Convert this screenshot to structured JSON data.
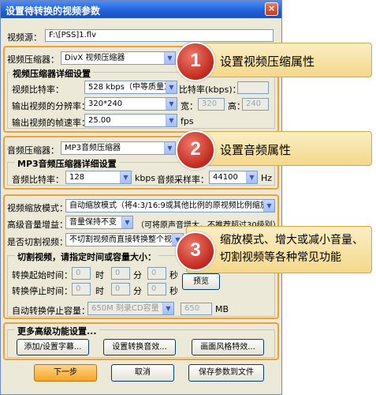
{
  "window": {
    "title": "设置待转换的视频参数",
    "close_glyph": "×"
  },
  "source": {
    "label": "视频源：",
    "value": "F:\\[PSS]1.flv"
  },
  "video_codec": {
    "label": "视频压缩器：",
    "value": "DivX 视频压缩器"
  },
  "video_detail": {
    "group_title": "视频压缩器详细设置",
    "bitrate_label": "视频比特率：",
    "bitrate_value": "528  kbps（中等质量）",
    "bitrate_unit_label": "比特率(kbps)：",
    "bitrate_unit_value": "",
    "resolution_label": "输出视频的分辨率：",
    "resolution_value": "320*240",
    "width_label": "宽：",
    "width_value": "320",
    "height_label": "高：",
    "height_value": "240",
    "fps_label": "输出视频的帧速率：",
    "fps_value": "25.00",
    "fps_unit": "fps"
  },
  "audio_codec": {
    "label": "音频压缩器：",
    "value": "MP3音频压缩器"
  },
  "audio_detail": {
    "group_title": "MP3音频压缩器详细设置",
    "bitrate_label": "音频比特率：",
    "bitrate_value": "128",
    "bitrate_unit": "kbps",
    "samplerate_label": "音频采样率：",
    "samplerate_value": "44100",
    "samplerate_unit": "Hz"
  },
  "scaling": {
    "label": "视频缩放模式：",
    "value": "自动缩放模式（将4:3/16:9或其他比例的原视频比例缩放）"
  },
  "volume": {
    "label": "高级音量增益：",
    "value": "音量保持不变",
    "note": "（可将原声音增大，不推荐超过30级别）"
  },
  "cut": {
    "label": "是否切割视频：",
    "value": "不切割视频而直接转换整个视频",
    "group_title": "切割视频，请指定时间或容量大小：",
    "start_label": "转换起始时间：",
    "end_label": "转换停止时间：",
    "hour": "时",
    "minute": "分",
    "second": "秒",
    "h_val": "0",
    "m_val": "0",
    "s_val": "0",
    "preview_button": "预览",
    "stop_capacity_label": "自动转换停止容量：",
    "stop_capacity_value": "650M 刻录CD容量",
    "capacity_value": "650",
    "capacity_unit": "MB"
  },
  "advanced": {
    "group_title": "更多高级功能设置...",
    "subtitle_button": "添加/设置字幕...",
    "watermark_button": "设置转换音效...",
    "effect_button": "画面风格特效..."
  },
  "footer": {
    "next_button": "下一步",
    "cancel_button": "取消",
    "save_button": "保存参数到文件"
  },
  "callouts": [
    {
      "num": "1",
      "text": "设置视频压缩属性"
    },
    {
      "num": "2",
      "text": "设置音频属性"
    },
    {
      "num": "3",
      "line1": "缩放模式、增大或减小音量、",
      "line2": "切割视频等各种常见功能"
    }
  ],
  "colors": {
    "accent": "#f0a030",
    "callout_bg": "#f4d88a",
    "badge": "#c0281c",
    "titlebar": "#1f5fd8"
  }
}
